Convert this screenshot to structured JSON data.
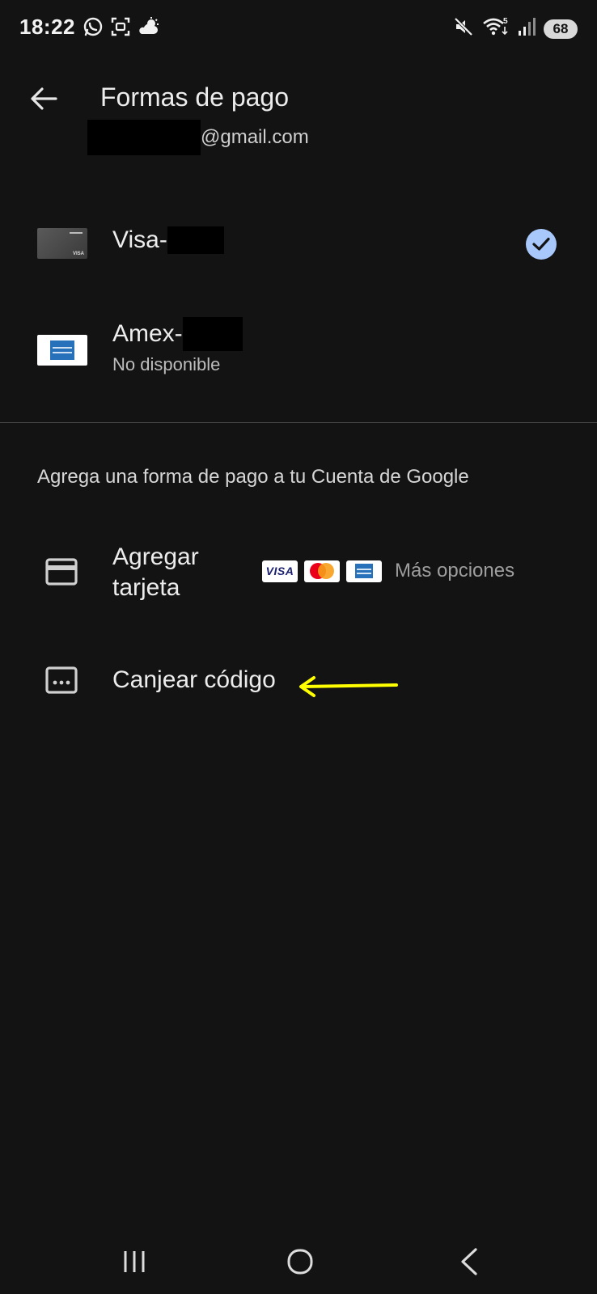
{
  "status_bar": {
    "time": "18:22",
    "battery": "68",
    "left_icons": [
      "whatsapp-icon",
      "screenshot-icon",
      "weather-icon"
    ],
    "right_icons": [
      "mute-icon",
      "wifi-icon",
      "signal-icon"
    ]
  },
  "app_bar": {
    "title": "Formas de pago",
    "account_email_suffix": "@gmail.com"
  },
  "payment_methods": [
    {
      "label": "Visa-",
      "sublabel": "",
      "selected": true,
      "icon": "visa-card-thumbnail"
    },
    {
      "label": "Amex-",
      "sublabel": "No disponible",
      "selected": false,
      "icon": "amex-card-thumbnail"
    }
  ],
  "add_section": {
    "heading": "Agrega una forma de pago a tu Cuenta de Google",
    "add_card": {
      "label_line1": "Agregar",
      "label_line2": "tarjeta",
      "brands": [
        "visa",
        "mastercard",
        "amex"
      ],
      "visa_text": "VISA",
      "more_options": "Más opciones"
    },
    "redeem_code": {
      "label": "Canjear código"
    }
  },
  "colors": {
    "background": "#131313",
    "check_accent": "#a8c7fa",
    "annotation_arrow": "#ffff00"
  },
  "nav_bar": {
    "buttons": [
      "recents-icon",
      "home-icon",
      "back-icon"
    ]
  }
}
